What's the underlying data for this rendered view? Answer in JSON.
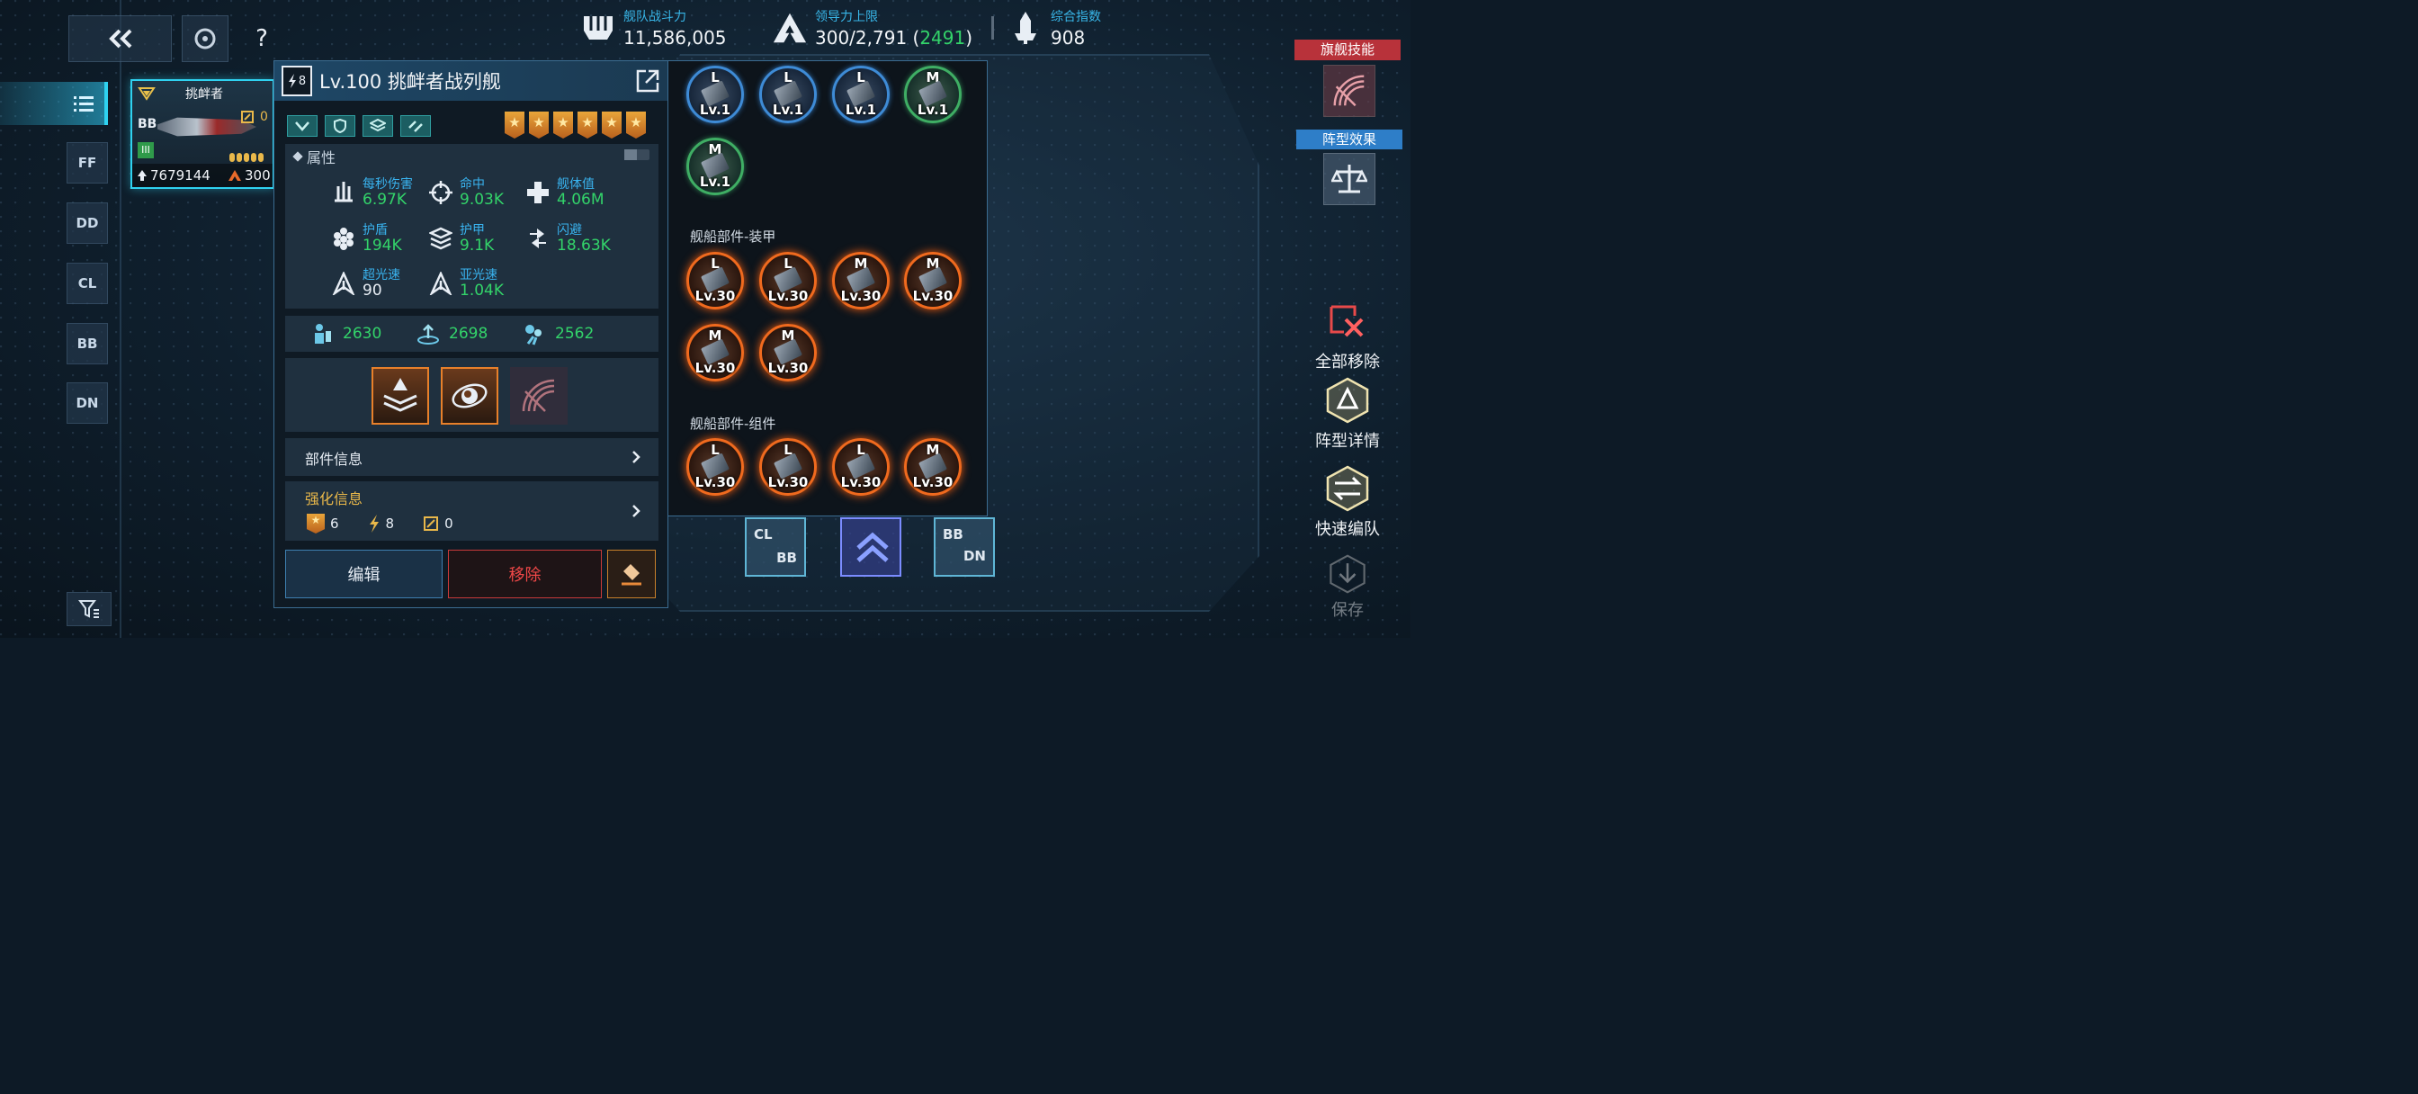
{
  "top": {
    "fleet_power_label": "舰队战斗力",
    "fleet_power_value": "11,586,005",
    "leadership_label": "领导力上限",
    "leadership_value": "300/2,791 (",
    "leadership_extra": "2491",
    "leadership_close": ")",
    "index_label": "综合指数",
    "index_value": "908",
    "help_label": "?"
  },
  "sidebar": {
    "classes": [
      "FF",
      "DD",
      "CL",
      "BB",
      "DN"
    ]
  },
  "ship_card": {
    "name": "挑衅者",
    "class": "BB",
    "count": "0",
    "power": "7679144",
    "command": "300"
  },
  "panel": {
    "tier": "8",
    "title": "Lv.100 挑衅者战列舰",
    "stars": 6,
    "attr_header": "属性",
    "attrs": [
      {
        "name": "每秒伤害",
        "value": "6.97K",
        "icon": "dps-icon"
      },
      {
        "name": "命中",
        "value": "9.03K",
        "icon": "crosshair-icon"
      },
      {
        "name": "舰体值",
        "value": "4.06M",
        "icon": "hull-icon"
      },
      {
        "name": "护盾",
        "value": "194K",
        "icon": "shield-hex-icon"
      },
      {
        "name": "护甲",
        "value": "9.1K",
        "icon": "armor-icon"
      },
      {
        "name": "闪避",
        "value": "18.63K",
        "icon": "dodge-icon"
      },
      {
        "name": "超光速",
        "value": "90",
        "icon": "warp-icon"
      },
      {
        "name": "亚光速",
        "value": "1.04K",
        "icon": "impulse-icon"
      }
    ],
    "resources": [
      "2630",
      "2698",
      "2562"
    ],
    "parts_info": "部件信息",
    "enhance_info": "强化信息",
    "enhance_values": [
      "6",
      "8",
      "0"
    ],
    "edit_button": "编辑",
    "remove_button": "移除"
  },
  "equipment": {
    "weapons": [
      {
        "tier": "L",
        "level": "Lv.1",
        "color": "blue"
      },
      {
        "tier": "L",
        "level": "Lv.1",
        "color": "blue"
      },
      {
        "tier": "L",
        "level": "Lv.1",
        "color": "blue"
      },
      {
        "tier": "M",
        "level": "Lv.1",
        "color": "green"
      },
      {
        "tier": "M",
        "level": "Lv.1",
        "color": "green"
      }
    ],
    "armor_label": "舰船部件-装甲",
    "armor": [
      {
        "tier": "L",
        "level": "Lv.30"
      },
      {
        "tier": "L",
        "level": "Lv.30"
      },
      {
        "tier": "M",
        "level": "Lv.30"
      },
      {
        "tier": "M",
        "level": "Lv.30"
      },
      {
        "tier": "M",
        "level": "Lv.30"
      },
      {
        "tier": "M",
        "level": "Lv.30"
      }
    ],
    "module_label": "舰船部件-组件",
    "modules": [
      {
        "tier": "L",
        "level": "Lv.30"
      },
      {
        "tier": "L",
        "level": "Lv.30"
      },
      {
        "tier": "L",
        "level": "Lv.30"
      },
      {
        "tier": "M",
        "level": "Lv.30"
      }
    ]
  },
  "formation": {
    "left_top": "CL",
    "left_bottom": "BB",
    "right_top": "BB",
    "right_bottom": "DN"
  },
  "right": {
    "flagship_skill": "旗舰技能",
    "formation_effect": "阵型效果",
    "remove_all": "全部移除",
    "formation_detail": "阵型详情",
    "quick_form": "快速编队",
    "save": "保存"
  },
  "colors": {
    "accent_cyan": "#2fd2f0",
    "value_green": "#33d46a",
    "label_blue": "#39b3ef",
    "remove_red": "#e83a3a",
    "orange_rarity": "#f06a1e"
  }
}
